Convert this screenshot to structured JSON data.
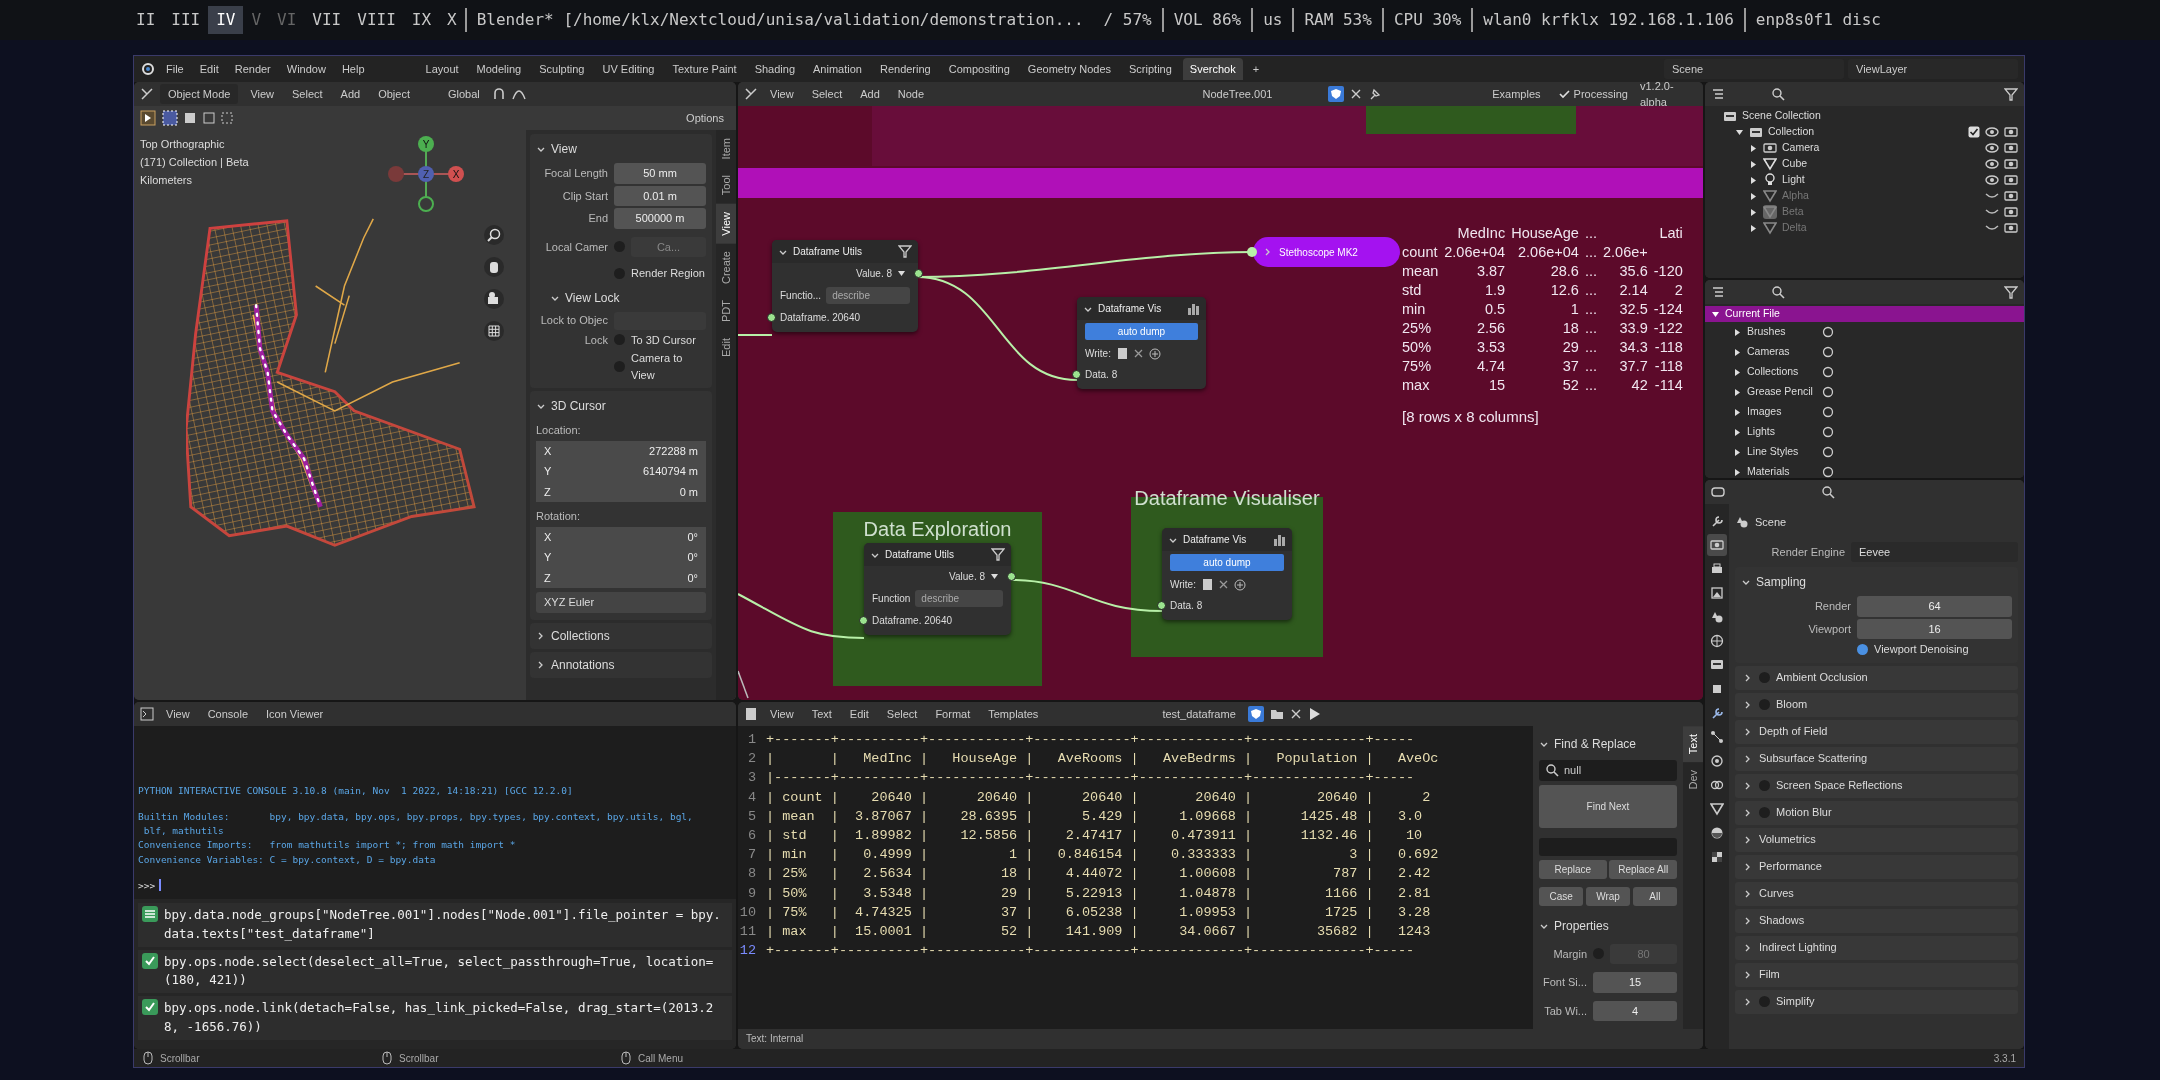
{
  "desktop_bar": {
    "workspaces": [
      {
        "label": "II",
        "selected": false,
        "occupied": true
      },
      {
        "label": "III",
        "selected": false,
        "occupied": true
      },
      {
        "label": "IV",
        "selected": true,
        "occupied": true
      },
      {
        "label": "V",
        "selected": false,
        "occupied": false
      },
      {
        "label": "VI",
        "selected": false,
        "occupied": false
      },
      {
        "label": "VII",
        "selected": false,
        "occupied": true
      },
      {
        "label": "VIII",
        "selected": false,
        "occupied": true
      },
      {
        "label": "IX",
        "selected": false,
        "occupied": true
      },
      {
        "label": "X",
        "selected": false,
        "occupied": true
      }
    ],
    "segments": [
      {
        "text": "Blender* [/home/klx/Nextcloud/unisa/validation/demonstration...",
        "divider_before": true
      },
      {
        "text": "/ 57%",
        "divider_before": false
      },
      {
        "text": "VOL 86%",
        "divider_before": true
      },
      {
        "text": "us",
        "divider_before": true
      },
      {
        "text": "RAM 53%",
        "divider_before": true
      },
      {
        "text": "CPU 30%",
        "divider_before": true
      },
      {
        "text": "wlan0 krfklx 192.168.1.106",
        "divider_before": true
      },
      {
        "text": "enp8s0f1 disc",
        "divider_before": true
      }
    ]
  },
  "topbar": {
    "menus": [
      "File",
      "Edit",
      "Render",
      "Window",
      "Help"
    ],
    "workspaces": [
      {
        "label": "Layout",
        "selected": false
      },
      {
        "label": "Modeling",
        "selected": false
      },
      {
        "label": "Sculpting",
        "selected": false
      },
      {
        "label": "UV Editing",
        "selected": false
      },
      {
        "label": "Texture Paint",
        "selected": false
      },
      {
        "label": "Shading",
        "selected": false
      },
      {
        "label": "Animation",
        "selected": false
      },
      {
        "label": "Rendering",
        "selected": false
      },
      {
        "label": "Compositing",
        "selected": false
      },
      {
        "label": "Geometry Nodes",
        "selected": false
      },
      {
        "label": "Scripting",
        "selected": false
      },
      {
        "label": "Sverchok",
        "selected": true
      }
    ],
    "add_tab": "+",
    "scene": "Scene",
    "view_layer": "ViewLayer"
  },
  "viewport": {
    "mode": "Object Mode",
    "menus": [
      "View",
      "Select",
      "Add",
      "Object"
    ],
    "orientation": "Global",
    "options": "Options",
    "overlay": [
      "Top Orthographic",
      "(171) Collection | Beta",
      "Kilometers"
    ],
    "gizmo": {
      "y": "Y",
      "z": "Z",
      "x": "X"
    },
    "sidebar_tabs": [
      {
        "label": "Item",
        "selected": false
      },
      {
        "label": "Tool",
        "selected": false
      },
      {
        "label": "View",
        "selected": true
      },
      {
        "label": "Create",
        "selected": false
      },
      {
        "label": "PDT",
        "selected": false
      },
      {
        "label": "Edit",
        "selected": false
      }
    ],
    "view_panel": {
      "title": "View",
      "fields": [
        {
          "label": "Focal Length",
          "value": "50 mm"
        },
        {
          "label": "Clip Start",
          "value": "0.01 m"
        },
        {
          "label": "End",
          "value": "500000 m"
        }
      ],
      "local_camera": {
        "label": "Local Camer",
        "checked": false,
        "value": "Ca..."
      },
      "render_region": {
        "label": "Render Region",
        "checked": false
      },
      "view_lock": {
        "title": "View Lock",
        "lock_label": "Lock to Objec",
        "lock": "Lock",
        "options": [
          {
            "label": "To 3D Cursor",
            "checked": false
          },
          {
            "label": "Camera to View",
            "checked": false
          }
        ]
      }
    },
    "cursor_panel": {
      "title": "3D Cursor",
      "location_label": "Location:",
      "location": [
        {
          "axis": "X",
          "value": "272288 m"
        },
        {
          "axis": "Y",
          "value": "6140794 m"
        },
        {
          "axis": "Z",
          "value": "0 m"
        }
      ],
      "rotation_label": "Rotation:",
      "rotation": [
        {
          "axis": "X",
          "value": "0°"
        },
        {
          "axis": "Y",
          "value": "0°"
        },
        {
          "axis": "Z",
          "value": "0°"
        }
      ],
      "rotation_mode": "XYZ Euler"
    },
    "collapsed_panels": [
      "Collections",
      "Annotations"
    ]
  },
  "node_editor": {
    "menus": [
      "View",
      "Select",
      "Add",
      "Node"
    ],
    "tree": "NodeTree.001",
    "examples": "Examples",
    "processing": {
      "label": "Processing",
      "checked": true
    },
    "version": "v1.2.0-alpha",
    "frames": [
      {
        "label": "Data Exploration"
      },
      {
        "label": "Dataframe Visualiser"
      }
    ],
    "nodes": [
      {
        "kind": "utils",
        "title": "Dataframe Utils",
        "output": "Value. 8",
        "field_label": "Functio...",
        "field_value": "describe",
        "input": "Dataframe. 20640"
      },
      {
        "kind": "vis",
        "title": "Dataframe Vis",
        "button": "auto dump",
        "write_label": "Write:",
        "input": "Data. 8"
      },
      {
        "kind": "stethoscope",
        "title": "Stethoscope MK2"
      },
      {
        "kind": "utils",
        "title": "Dataframe Utils",
        "output": "Value. 8",
        "field_label": "Function",
        "field_value": "describe",
        "input": "Dataframe. 20640"
      },
      {
        "kind": "vis",
        "title": "Dataframe Vis",
        "button": "auto dump",
        "write_label": "Write:",
        "input": "Data. 8"
      }
    ],
    "stethoscope_output": {
      "header": [
        "MedInc",
        "HouseAge",
        "...",
        "Lati"
      ],
      "rows": [
        {
          "label": "count",
          "cells": [
            "2.06e+04",
            "2.06e+04",
            "...",
            "2.06e+"
          ]
        },
        {
          "label": "mean",
          "cells": [
            "3.87",
            "28.6",
            "...",
            "35.6",
            "-120"
          ]
        },
        {
          "label": "std",
          "cells": [
            "1.9",
            "12.6",
            "...",
            "2.14",
            "2"
          ]
        },
        {
          "label": "min",
          "cells": [
            "0.5",
            "1",
            "...",
            "32.5",
            "-124"
          ]
        },
        {
          "label": "25%",
          "cells": [
            "2.56",
            "18",
            "...",
            "33.9",
            "-122"
          ]
        },
        {
          "label": "50%",
          "cells": [
            "3.53",
            "29",
            "...",
            "34.3",
            "-118"
          ]
        },
        {
          "label": "75%",
          "cells": [
            "4.74",
            "37",
            "...",
            "37.7",
            "-118"
          ]
        },
        {
          "label": "max",
          "cells": [
            "15",
            "52",
            "...",
            "42",
            "-114"
          ]
        }
      ],
      "footer": "[8 rows x 8 columns]"
    }
  },
  "outliner": {
    "root": "Scene Collection",
    "items": [
      {
        "label": "Collection",
        "kind": "collection",
        "checked": true,
        "expanded": true,
        "children": [
          {
            "label": "Camera",
            "kind": "camera",
            "visible": true,
            "active": false
          },
          {
            "label": "Cube",
            "kind": "mesh",
            "visible": true,
            "active": false
          },
          {
            "label": "Light",
            "kind": "light",
            "visible": true,
            "active": false
          },
          {
            "label": "Alpha",
            "kind": "mesh",
            "visible": false,
            "active": false
          },
          {
            "label": "Beta",
            "kind": "mesh",
            "visible": false,
            "active": true
          },
          {
            "label": "Delta",
            "kind": "mesh",
            "visible": false,
            "active": false
          }
        ]
      }
    ]
  },
  "file_view": {
    "root": "Current File",
    "items": [
      "Brushes",
      "Cameras",
      "Collections",
      "Grease Pencil",
      "Images",
      "Lights",
      "Line Styles",
      "Materials"
    ]
  },
  "properties": {
    "tabs": [
      {
        "selected": false
      },
      {
        "selected": true
      },
      {
        "selected": false
      },
      {
        "selected": false
      },
      {
        "selected": false
      },
      {
        "selected": false
      },
      {
        "selected": false
      },
      {
        "selected": false
      },
      {
        "selected": false
      },
      {
        "selected": false
      },
      {
        "selected": false
      },
      {
        "selected": false
      },
      {
        "selected": false
      },
      {
        "selected": false
      },
      {
        "selected": false
      }
    ],
    "context": "Scene",
    "render_engine": {
      "label": "Render Engine",
      "value": "Eevee"
    },
    "sampling": {
      "title": "Sampling",
      "fields": [
        {
          "label": "Render",
          "value": "64"
        },
        {
          "label": "Viewport",
          "value": "16"
        }
      ],
      "denoise": {
        "label": "Viewport Denoising",
        "checked": true
      }
    },
    "panels": [
      {
        "label": "Ambient Occlusion",
        "kind": "toggle",
        "checked": false
      },
      {
        "label": "Bloom",
        "kind": "toggle",
        "checked": false
      },
      {
        "label": "Depth of Field",
        "kind": "plain"
      },
      {
        "label": "Subsurface Scattering",
        "kind": "plain"
      },
      {
        "label": "Screen Space Reflections",
        "kind": "toggle",
        "checked": false
      },
      {
        "label": "Motion Blur",
        "kind": "toggle",
        "checked": false
      },
      {
        "label": "Volumetrics",
        "kind": "plain"
      },
      {
        "label": "Performance",
        "kind": "plain"
      },
      {
        "label": "Curves",
        "kind": "plain"
      },
      {
        "label": "Shadows",
        "kind": "plain"
      },
      {
        "label": "Indirect Lighting",
        "kind": "plain"
      },
      {
        "label": "Film",
        "kind": "plain"
      },
      {
        "label": "Simplify",
        "kind": "toggle",
        "checked": false
      }
    ]
  },
  "console": {
    "menus": [
      "View",
      "Console",
      "Icon Viewer"
    ],
    "lines": [
      "PYTHON INTERACTIVE CONSOLE 3.10.8 (main, Nov  1 2022, 14:18:21) [GCC 12.2.0]",
      "Builtin Modules:       bpy, bpy.data, bpy.ops, bpy.props, bpy.types, bpy.context, bpy.utils, bgl,",
      " blf, mathutils",
      "Convenience Imports:   from mathutils import *; from math import *",
      "Convenience Variables: C = bpy.context, D = bpy.data"
    ],
    "prompt": ">>>",
    "log": [
      {
        "kind": "property",
        "text": "bpy.data.node_groups[\"NodeTree.001\"].nodes[\"Node.001\"].file_pointer = bpy.data.texts[\"test_dataframe\"]"
      },
      {
        "kind": "operator",
        "text": "bpy.ops.node.select(deselect_all=True, select_passthrough=True, location=(180, 421))"
      },
      {
        "kind": "operator",
        "text": "bpy.ops.node.link(detach=False, has_link_picked=False, drag_start=(2013.28, -1656.76))"
      }
    ]
  },
  "text_editor": {
    "menus": [
      "View",
      "Text",
      "Edit",
      "Select",
      "Format",
      "Templates"
    ],
    "file": "test_dataframe",
    "lines": [
      {
        "number": "1",
        "current": false,
        "text": "+-------+----------+------------+------------+-------------+--------------+-----"
      },
      {
        "number": "2",
        "current": false,
        "text": "|       |   MedInc |   HouseAge |   AveRooms |   AveBedrms |   Population |   AveOc"
      },
      {
        "number": "3",
        "current": false,
        "text": "|-------+----------+------------+------------+-------------+--------------+-----"
      },
      {
        "number": "4",
        "current": false,
        "text": "| count |    20640 |      20640 |      20640 |       20640 |        20640 |      2"
      },
      {
        "number": "5",
        "current": false,
        "text": "| mean  |  3.87067 |    28.6395 |      5.429 |     1.09668 |      1425.48 |   3.0"
      },
      {
        "number": "6",
        "current": false,
        "text": "| std   |  1.89982 |    12.5856 |    2.47417 |    0.473911 |      1132.46 |    10"
      },
      {
        "number": "7",
        "current": false,
        "text": "| min   |   0.4999 |          1 |   0.846154 |    0.333333 |            3 |   0.692"
      },
      {
        "number": "8",
        "current": false,
        "text": "| 25%   |   2.5634 |         18 |    4.44072 |     1.00608 |          787 |   2.42"
      },
      {
        "number": "9",
        "current": false,
        "text": "| 50%   |   3.5348 |         29 |    5.22913 |     1.04878 |         1166 |   2.81"
      },
      {
        "number": "10",
        "current": false,
        "text": "| 75%   |  4.74325 |         37 |    6.05238 |     1.09953 |         1725 |   3.28"
      },
      {
        "number": "11",
        "current": false,
        "text": "| max   |  15.0001 |         52 |    141.909 |     34.0667 |        35682 |   1243"
      },
      {
        "number": "12",
        "current": true,
        "text": "+-------+----------+------------+------------+-------------+--------------+-----"
      }
    ],
    "sidebar_tabs": [
      {
        "label": "Text",
        "selected": true
      },
      {
        "label": "Dev",
        "selected": false
      }
    ],
    "find": {
      "title": "Find & Replace",
      "find_value": "null",
      "find_next": "Find Next",
      "replace": "Replace",
      "replace_all": "Replace All",
      "toggles": [
        {
          "label": "Case",
          "on": false
        },
        {
          "label": "Wrap",
          "on": false
        },
        {
          "label": "All",
          "on": false
        }
      ]
    },
    "props": {
      "title": "Properties",
      "margin": {
        "label": "Margin",
        "checked": false,
        "value": "80"
      },
      "fields": [
        {
          "label": "Font Si...",
          "value": "15"
        },
        {
          "label": "Tab Wi...",
          "value": "4"
        }
      ]
    },
    "footer": "Text: Internal"
  },
  "status_bar": {
    "hints": [
      "Scrollbar",
      "Scrollbar",
      "Call Menu"
    ],
    "version": "3.3.1"
  }
}
